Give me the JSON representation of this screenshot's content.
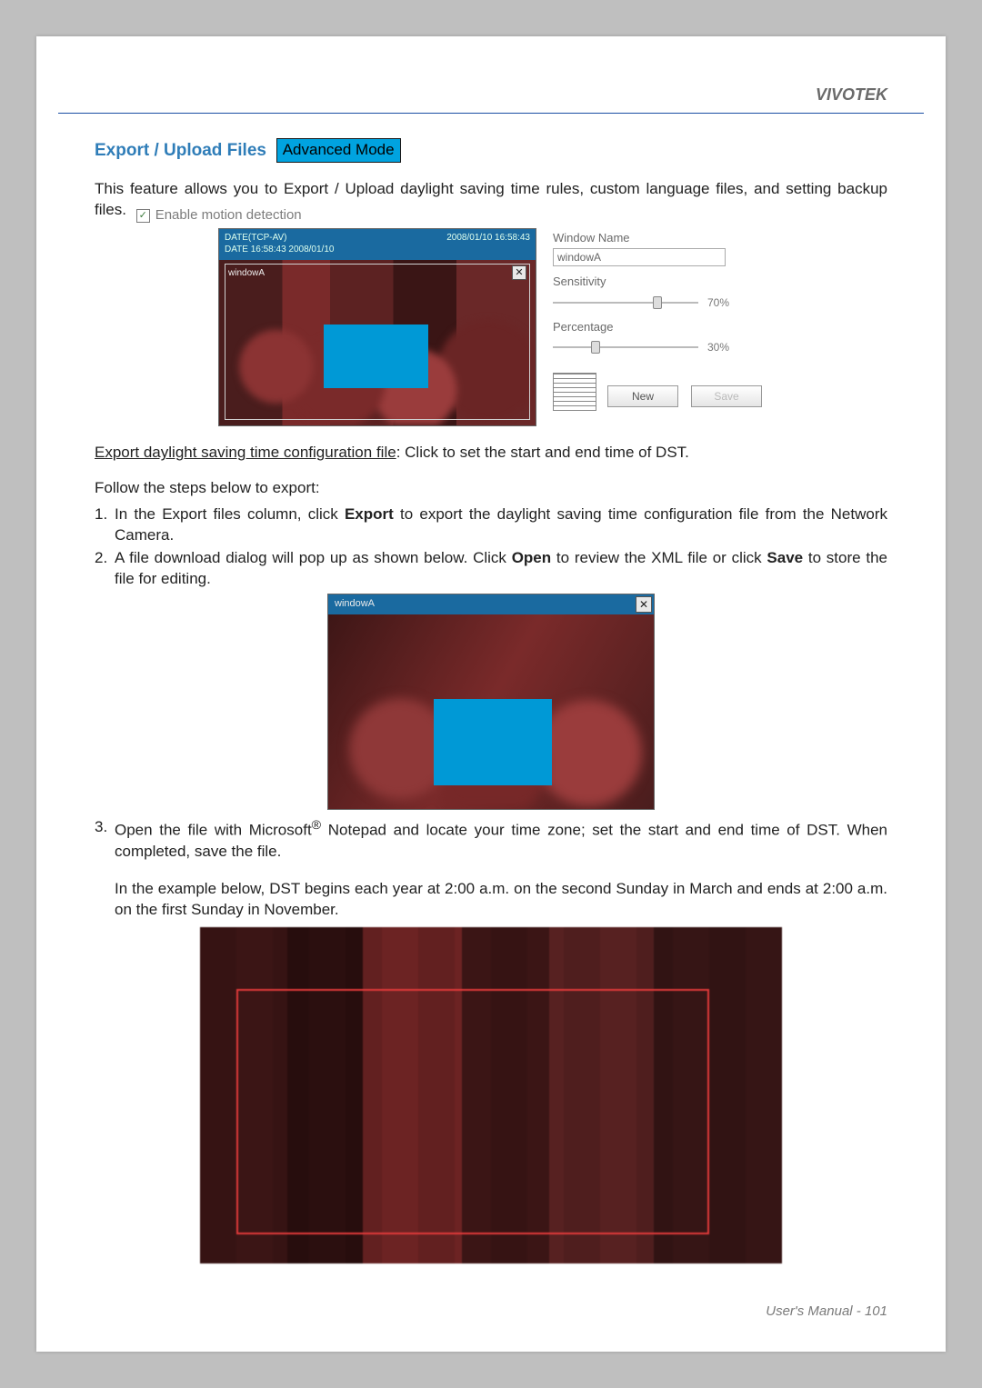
{
  "brand": "VIVOTEK",
  "section": {
    "title": "Export / Upload Files",
    "badge": "Advanced Mode"
  },
  "intro": "This feature allows you to Export / Upload daylight saving time rules, custom language files, and setting backup files.",
  "checkbox_label": "Enable motion detection",
  "preview": {
    "line1": "DATE(TCP-AV)",
    "line1_right": "2008/01/10 16:58:43",
    "line2": "DATE 16:58:43 2008/01/10",
    "wndlabel": "windowA",
    "close": "✕"
  },
  "controls": {
    "window_name_label": "Window Name",
    "window_name_value": "windowA",
    "sensitivity_label": "Sensitivity",
    "sensitivity_value": "70%",
    "percentage_label": "Percentage",
    "percentage_value": "30%",
    "new_btn": "New",
    "save_btn": "Save"
  },
  "export_link": "Export daylight saving time configuration file",
  "export_rest": ": Click to set the start and end time of DST.",
  "follow": "Follow the steps below to export:",
  "steps": {
    "s1_a": "In the Export files column, click ",
    "s1_bold": "Export",
    "s1_b": " to export the daylight saving time configuration file from the Network Camera.",
    "s2_a": "A file download dialog will pop up as shown below. Click ",
    "s2_bold1": "Open",
    "s2_b": " to review the XML file or click ",
    "s2_bold2": "Save",
    "s2_c": " to store the file for editing.",
    "s3_a": "Open the file with Microsoft",
    "s3_sup": "®",
    "s3_b": " Notepad and locate your time zone; set the start and end time of DST. When completed, save the file."
  },
  "fig2": {
    "title": "windowA",
    "close": "✕"
  },
  "example": "In the example below, DST begins each year at 2:00 a.m. on the second Sunday in March and ends at 2:00 a.m. on the first Sunday in November.",
  "footer": "User's Manual - 101"
}
